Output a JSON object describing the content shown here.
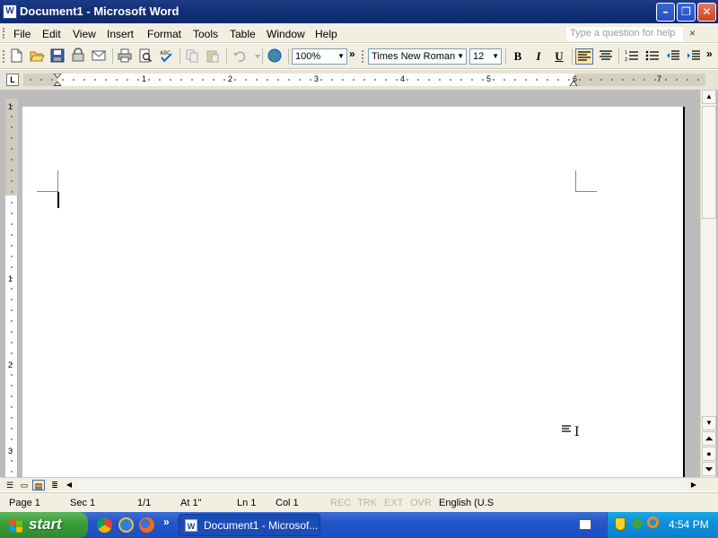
{
  "window": {
    "title": "Document1 - Microsoft Word",
    "app_icon": "W",
    "controls": {
      "minimize": "–",
      "restore": "❐",
      "close": "✕"
    }
  },
  "menubar": {
    "items": [
      {
        "label": "File"
      },
      {
        "label": "Edit"
      },
      {
        "label": "View"
      },
      {
        "label": "Insert"
      },
      {
        "label": "Format"
      },
      {
        "label": "Tools"
      },
      {
        "label": "Table"
      },
      {
        "label": "Window"
      },
      {
        "label": "Help"
      }
    ],
    "help_placeholder": "Type a question for help",
    "help_close": "×"
  },
  "toolbar": {
    "zoom": "100%",
    "overflow": "»",
    "font": "Times New Roman",
    "font_size": "12",
    "bold": "B",
    "italic": "I",
    "underline": "U"
  },
  "ruler": {
    "tab_selector": "L",
    "numbers": [
      "1",
      "2",
      "3",
      "4",
      "5",
      "6",
      "7"
    ],
    "vertical_numbers": [
      "1",
      "1",
      "2",
      "3"
    ]
  },
  "document": {
    "content": ""
  },
  "statusbar": {
    "page": "Page 1",
    "section": "Sec 1",
    "pages": "1/1",
    "at": "At 1\"",
    "line": "Ln 1",
    "col": "Col 1",
    "rec": "REC",
    "trk": "TRK",
    "ext": "EXT",
    "ovr": "OVR",
    "language": "English (U.S"
  },
  "taskbar": {
    "start_label": "start",
    "quick_launch_more": "»",
    "task": "Document1 - Microsof...",
    "task_icon": "W",
    "clock": "4:54 PM"
  },
  "colors": {
    "titlebar": "#123075",
    "chrome": "#f1efe2",
    "workspace": "#bcbcbc",
    "taskbar": "#2455c8",
    "start": "#3a9b38",
    "tray": "#0f8ed8",
    "active_button": "#ffe6a8"
  }
}
